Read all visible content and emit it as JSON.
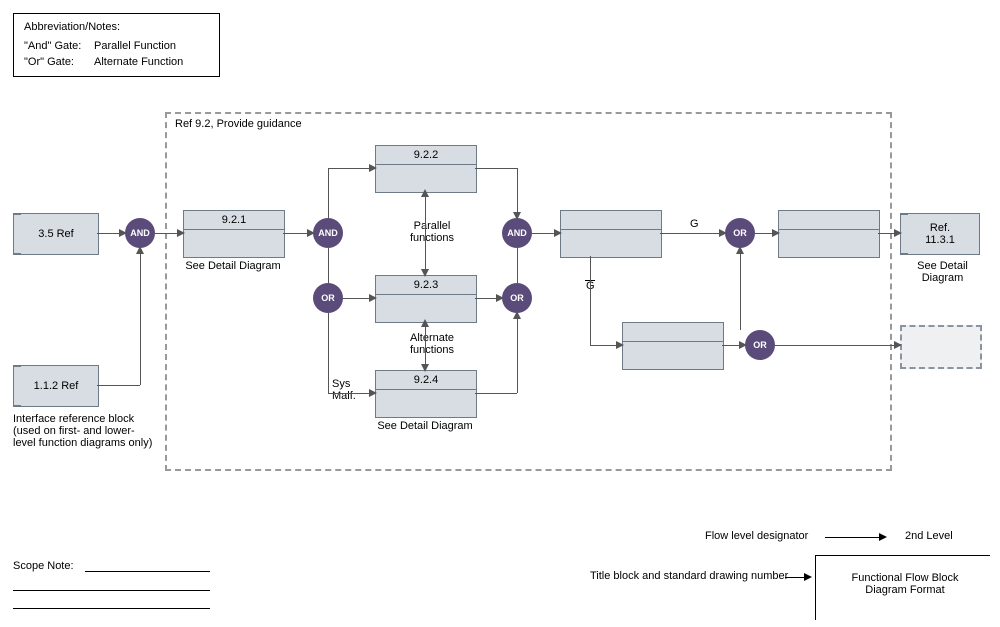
{
  "notes": {
    "title": "Abbreviation/Notes:",
    "and_key": "\"And\" Gate:",
    "and_val": "Parallel Function",
    "or_key": "\"Or\" Gate:",
    "or_val": "Alternate Function"
  },
  "frame": {
    "label": "Ref 9.2, Provide guidance"
  },
  "ref_blocks": {
    "b35": "3.5 Ref",
    "b112": "1.1.2 Ref",
    "b1131": "Ref.\n11.3.1"
  },
  "func_blocks": {
    "b921": "9.2.1",
    "b922": "9.2.2",
    "b923": "9.2.3",
    "b924": "9.2.4"
  },
  "gates": {
    "and": "AND",
    "or": "OR"
  },
  "captions": {
    "see_detail": "See Detail Diagram",
    "parallel": "Parallel\nfunctions",
    "alternate": "Alternate\nfunctions",
    "sys_malf": "Sys\nMalf.",
    "iface": "Interface reference block\n(used on first- and lower-\nlevel function diagrams only)"
  },
  "signals": {
    "g": "G",
    "g_bar": "G"
  },
  "footer": {
    "scope": "Scope Note:",
    "flow_designator": "Flow level designator",
    "second_level": "2nd Level",
    "title_block": "Title block and standard drawing number",
    "ffbd": "Functional Flow Block\nDiagram Format"
  }
}
